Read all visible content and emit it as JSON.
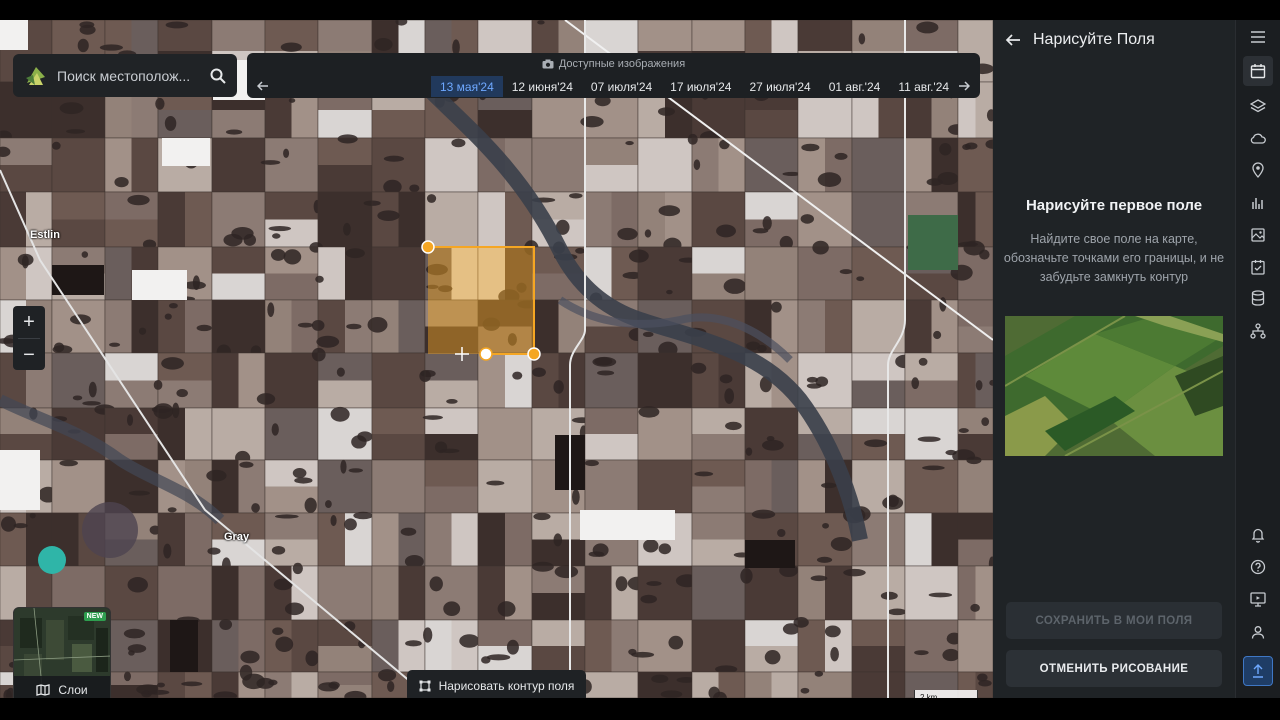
{
  "search": {
    "placeholder": "Поиск местополож..."
  },
  "timeline": {
    "title": "Доступные изображения",
    "dates": [
      "13 мая'24",
      "12 июня'24",
      "07 июля'24",
      "17 июля'24",
      "27 июля'24",
      "01 авг.'24",
      "11 авг.'24"
    ],
    "active_index": 0
  },
  "map": {
    "cities": {
      "estlin": "Estlin",
      "gray": "Gray"
    },
    "minimap": {
      "badge": "NEW",
      "label": "Слои"
    },
    "draw_button": "Нарисовать контур поля",
    "scale": "2 km",
    "accent_color": "#f5a623"
  },
  "panel": {
    "title": "Нарисуйте Поля",
    "subtitle": "Нарисуйте первое поле",
    "description": "Найдите свое поле на карте, обозначьте точками его границы, и не забудьте замкнуть контур",
    "save_button": "СОХРАНИТЬ В МОИ ПОЛЯ",
    "cancel_button": "ОТМЕНИТЬ РИСОВАНИЕ"
  },
  "rail": {
    "icons": [
      "menu-icon",
      "calendar-icon",
      "layers-icon",
      "cloud-icon",
      "location-pin-icon",
      "analytics-icon",
      "image-icon",
      "tasks-icon",
      "database-icon",
      "structure-icon",
      "bell-icon",
      "help-icon",
      "monitor-icon",
      "user-icon",
      "upload-icon"
    ]
  }
}
